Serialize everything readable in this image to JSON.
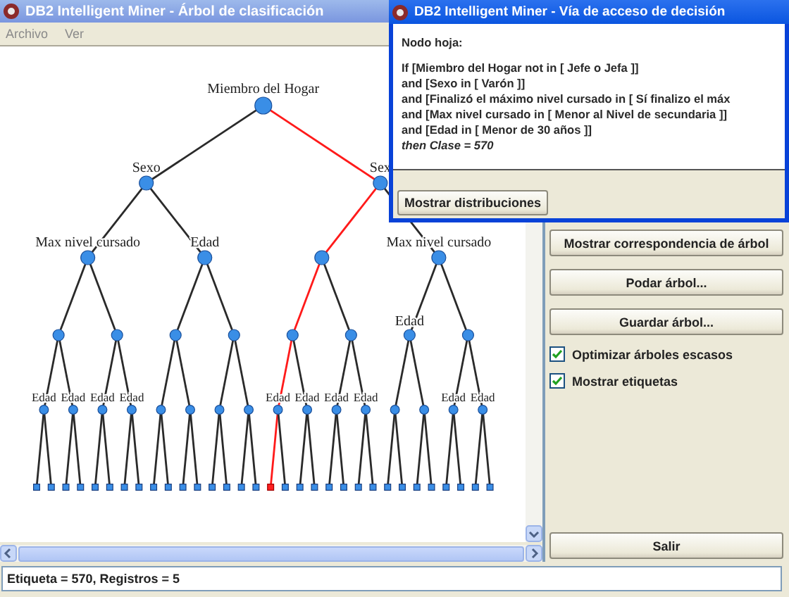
{
  "main_window": {
    "title": "DB2 Intelligent Miner - Árbol de clasificación",
    "menu": [
      "Archivo",
      "Ver"
    ]
  },
  "tree": {
    "label": "Miembro del Hogar",
    "children": [
      {
        "label": "Sexo",
        "on_path": false,
        "children": [
          {
            "label": "Max nivel cursado",
            "on_path": false,
            "children": [
              {
                "on_path": false,
                "children": [
                  {
                    "label": "Edad",
                    "on_path": false,
                    "children": [
                      {
                        "on_path": false
                      },
                      {
                        "on_path": false
                      }
                    ]
                  },
                  {
                    "label": "Edad",
                    "on_path": false,
                    "children": [
                      {
                        "on_path": false
                      },
                      {
                        "on_path": false
                      }
                    ]
                  }
                ]
              },
              {
                "on_path": false,
                "children": [
                  {
                    "label": "Edad",
                    "on_path": false,
                    "children": [
                      {
                        "on_path": false
                      },
                      {
                        "on_path": false
                      }
                    ]
                  },
                  {
                    "label": "Edad",
                    "on_path": false,
                    "children": [
                      {
                        "on_path": false
                      },
                      {
                        "on_path": false
                      }
                    ]
                  }
                ]
              }
            ]
          },
          {
            "label": "Edad",
            "on_path": false,
            "children": [
              {
                "on_path": false,
                "children": [
                  {
                    "on_path": false,
                    "children": [
                      {
                        "on_path": false
                      },
                      {
                        "on_path": false
                      }
                    ]
                  },
                  {
                    "on_path": false,
                    "children": [
                      {
                        "on_path": false
                      },
                      {
                        "on_path": false
                      }
                    ]
                  }
                ]
              },
              {
                "on_path": false,
                "children": [
                  {
                    "on_path": false,
                    "children": [
                      {
                        "on_path": false
                      },
                      {
                        "on_path": false
                      }
                    ]
                  },
                  {
                    "on_path": false,
                    "children": [
                      {
                        "on_path": false
                      },
                      {
                        "on_path": false
                      }
                    ]
                  }
                ]
              }
            ]
          }
        ]
      },
      {
        "label": "Sex",
        "on_path": true,
        "children": [
          {
            "on_path": true,
            "children": [
              {
                "on_path": true,
                "children": [
                  {
                    "label": "Edad",
                    "on_path": true,
                    "children": [
                      {
                        "on_path": true
                      },
                      {
                        "on_path": false
                      }
                    ]
                  },
                  {
                    "label": "Edad",
                    "on_path": false,
                    "children": [
                      {
                        "on_path": false
                      },
                      {
                        "on_path": false
                      }
                    ]
                  }
                ]
              },
              {
                "on_path": false,
                "children": [
                  {
                    "label": "Edad",
                    "on_path": false,
                    "children": [
                      {
                        "on_path": false
                      },
                      {
                        "on_path": false
                      }
                    ]
                  },
                  {
                    "label": "Edad",
                    "on_path": false,
                    "children": [
                      {
                        "on_path": false
                      },
                      {
                        "on_path": false
                      }
                    ]
                  }
                ]
              }
            ]
          },
          {
            "label": "Max nivel cursado",
            "on_path": false,
            "children": [
              {
                "label": "Edad",
                "on_path": false,
                "children": [
                  {
                    "on_path": false,
                    "children": [
                      {
                        "on_path": false
                      },
                      {
                        "on_path": false
                      }
                    ]
                  },
                  {
                    "on_path": false,
                    "children": [
                      {
                        "on_path": false
                      },
                      {
                        "on_path": false
                      }
                    ]
                  }
                ]
              },
              {
                "on_path": false,
                "children": [
                  {
                    "label": "Edad",
                    "on_path": false,
                    "children": [
                      {
                        "on_path": false
                      },
                      {
                        "on_path": false
                      }
                    ]
                  },
                  {
                    "label": "Edad",
                    "on_path": false,
                    "children": [
                      {
                        "on_path": false
                      },
                      {
                        "on_path": false
                      }
                    ]
                  }
                ]
              }
            ]
          }
        ]
      }
    ]
  },
  "side_panel": {
    "buttons": [
      "Mostrar correspondencia de árbol",
      "Podar árbol...",
      "Guardar árbol..."
    ],
    "options": [
      {
        "label": "Optimizar árboles escasos",
        "checked": true
      },
      {
        "label": "Mostrar etiquetas",
        "checked": true
      }
    ],
    "exit_button": "Salir"
  },
  "status_bar": "Etiqueta = 570, Registros = 5",
  "dialog": {
    "title": "DB2 Intelligent Miner - Vía de acceso de decisión",
    "heading": "Nodo hoja:",
    "rule_lines": [
      {
        "text": "If [Miembro del Hogar not in [ Jefe o Jefa ]]",
        "kind": "plain"
      },
      {
        "text": "and [Sexo in [ Varón ]]",
        "kind": "plain"
      },
      {
        "text": "and [Finalizó el máximo nivel cursado in [ Sí finalizo el máx",
        "kind": "plain"
      },
      {
        "text": "and [Max nivel cursado in [ Menor al Nivel de secundaria ]]",
        "kind": "plain"
      },
      {
        "text": "and [Edad in [ Menor de 30 años ]]",
        "kind": "plain"
      },
      {
        "text": "then Clase = 570",
        "kind": "conclusion"
      }
    ],
    "button": "Mostrar distribuciones"
  }
}
